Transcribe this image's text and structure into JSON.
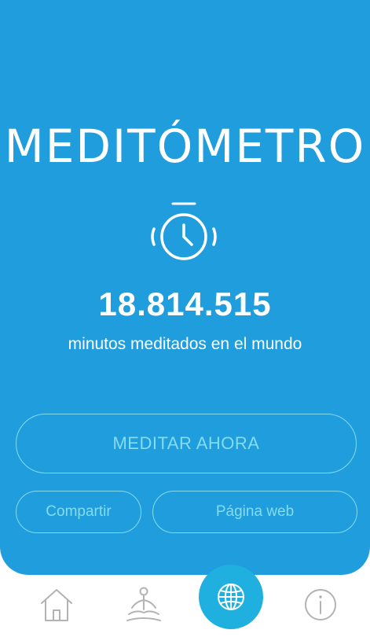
{
  "app": {
    "logo_text": "MEDITÓMETRO"
  },
  "stats": {
    "minutes_total": "18.814.515",
    "caption": "minutos meditados en el mundo"
  },
  "actions": {
    "meditate_label": "MEDITAR AHORA",
    "share_label": "Compartir",
    "website_label": "Página web"
  },
  "tabbar": {
    "items": [
      {
        "icon": "home-icon",
        "active": false
      },
      {
        "icon": "meditation-figure-icon",
        "active": false
      },
      {
        "icon": "globe-icon",
        "active": true
      },
      {
        "icon": "info-icon",
        "active": false
      }
    ]
  },
  "colors": {
    "panel_background": "#1f9ddd",
    "button_outline": "#84dcef",
    "active_tab_background": "#1fb0e0",
    "inactive_icon": "#b3b3b3",
    "text": "#ffffff"
  }
}
